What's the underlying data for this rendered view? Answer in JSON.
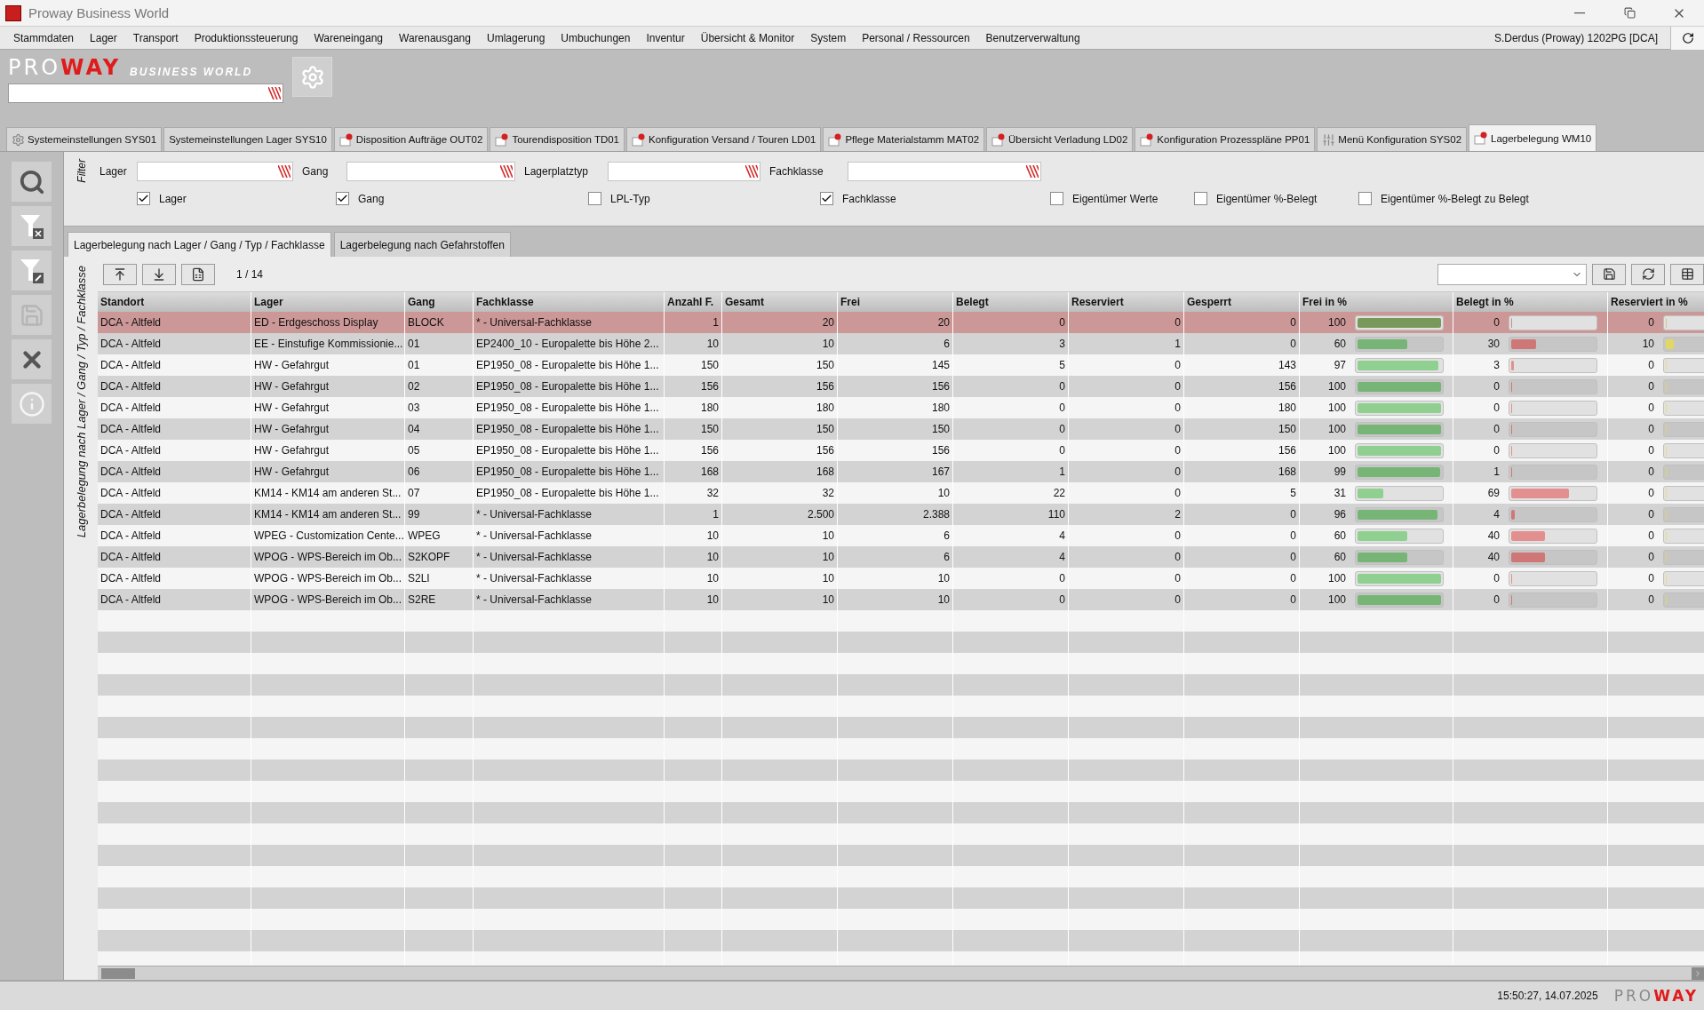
{
  "window": {
    "title": "Proway Business World"
  },
  "menu": {
    "items": [
      "Stammdaten",
      "Lager",
      "Transport",
      "Produktionssteuerung",
      "Wareneingang",
      "Warenausgang",
      "Umlagerung",
      "Umbuchungen",
      "Inventur",
      "Übersicht & Monitor",
      "System",
      "Personal / Ressourcen",
      "Benutzerverwaltung"
    ],
    "user": "S.Derdus (Proway) 1202PG [DCA]"
  },
  "logo": {
    "part_1": "PRO",
    "part_2": "WAY",
    "subtitle": "BUSINESS WORLD"
  },
  "tabs": [
    {
      "label": "Systemeinstellungen SYS01",
      "kind": "gear",
      "selected": false
    },
    {
      "label": "Systemeinstellungen Lager SYS10",
      "kind": "plain",
      "selected": false
    },
    {
      "label": "Disposition Aufträge OUT02",
      "kind": "document",
      "selected": false
    },
    {
      "label": "Tourendisposition TD01",
      "kind": "document",
      "selected": false
    },
    {
      "label": "Konfiguration Versand / Touren LD01",
      "kind": "document",
      "selected": false
    },
    {
      "label": "Pflege Materialstamm MAT02",
      "kind": "document",
      "selected": false
    },
    {
      "label": "Übersicht Verladung LD02",
      "kind": "document",
      "selected": false
    },
    {
      "label": "Konfiguration Prozesspläne PP01",
      "kind": "document",
      "selected": false
    },
    {
      "label": "Menü Konfiguration SYS02",
      "kind": "sliders",
      "selected": false
    },
    {
      "label": "Lagerbelegung WM10",
      "kind": "document",
      "selected": true
    }
  ],
  "filter": {
    "title": "Filter",
    "fields": [
      "Lager",
      "Gang",
      "Lagerplatztyp",
      "Fachklasse"
    ],
    "checkboxes": [
      {
        "label": "Lager",
        "checked": true
      },
      {
        "label": "Gang",
        "checked": true
      },
      {
        "label": "LPL-Typ",
        "checked": false
      },
      {
        "label": "Fachklasse",
        "checked": true
      },
      {
        "label": "Eigentümer Werte",
        "checked": false
      },
      {
        "label": "Eigentümer %-Belegt",
        "checked": false
      },
      {
        "label": "Eigentümer %-Belegt zu Belegt",
        "checked": false
      }
    ]
  },
  "subtabs": [
    {
      "label": "Lagerbelegung nach Lager / Gang / Typ / Fachklasse",
      "selected": true
    },
    {
      "label": "Lagerbelegung nach Gefahrstoffen",
      "selected": false
    }
  ],
  "side_label": "Lagerbelegung nach Lager / Gang / Typ / Fachklasse",
  "table": {
    "pager": "1 / 14",
    "columns": [
      "Standort",
      "Lager",
      "Gang",
      "Fachklasse",
      "Anzahl F.",
      "Gesamt",
      "Frei",
      "Belegt",
      "Reserviert",
      "Gesperrt",
      "Frei in %",
      "Belegt in %",
      "Reserviert in %"
    ],
    "rows": [
      {
        "selected": true,
        "cells": [
          "DCA - Altfeld",
          "ED - Erdgeschoss Display",
          "BLOCK",
          "* - Universal-Fachklasse",
          "1",
          "20",
          "20",
          "0",
          "0",
          "0"
        ],
        "bars": [
          {
            "value": "100",
            "level": 1
          },
          {
            "value": "0",
            "level": 0
          },
          {
            "value": "0",
            "level": 0
          }
        ]
      },
      {
        "selected": false,
        "cells": [
          "DCA - Altfeld",
          "EE - Einstufige Kommissionie...",
          "01",
          "EP2400_10 - Europalette bis Höhe 2...",
          "10",
          "10",
          "6",
          "3",
          "1",
          "0"
        ],
        "bars": [
          {
            "value": "60",
            "level": 0.6
          },
          {
            "value": "30",
            "level": 0.3
          },
          {
            "value": "10",
            "level": 0.1
          }
        ]
      },
      {
        "selected": false,
        "cells": [
          "DCA - Altfeld",
          "HW - Gefahrgut",
          "01",
          "EP1950_08 - Europalette bis Höhe 1...",
          "150",
          "150",
          "145",
          "5",
          "0",
          "143"
        ],
        "bars": [
          {
            "value": "97",
            "level": 0.97
          },
          {
            "value": "3",
            "level": 0.03
          },
          {
            "value": "0",
            "level": 0
          }
        ]
      },
      {
        "selected": false,
        "cells": [
          "DCA - Altfeld",
          "HW - Gefahrgut",
          "02",
          "EP1950_08 - Europalette bis Höhe 1...",
          "156",
          "156",
          "156",
          "0",
          "0",
          "156"
        ],
        "bars": [
          {
            "value": "100",
            "level": 1
          },
          {
            "value": "0",
            "level": 0
          },
          {
            "value": "0",
            "level": 0
          }
        ]
      },
      {
        "selected": false,
        "cells": [
          "DCA - Altfeld",
          "HW - Gefahrgut",
          "03",
          "EP1950_08 - Europalette bis Höhe 1...",
          "180",
          "180",
          "180",
          "0",
          "0",
          "180"
        ],
        "bars": [
          {
            "value": "100",
            "level": 1
          },
          {
            "value": "0",
            "level": 0
          },
          {
            "value": "0",
            "level": 0
          }
        ]
      },
      {
        "selected": false,
        "cells": [
          "DCA - Altfeld",
          "HW - Gefahrgut",
          "04",
          "EP1950_08 - Europalette bis Höhe 1...",
          "150",
          "150",
          "150",
          "0",
          "0",
          "150"
        ],
        "bars": [
          {
            "value": "100",
            "level": 1
          },
          {
            "value": "0",
            "level": 0
          },
          {
            "value": "0",
            "level": 0
          }
        ]
      },
      {
        "selected": false,
        "cells": [
          "DCA - Altfeld",
          "HW - Gefahrgut",
          "05",
          "EP1950_08 - Europalette bis Höhe 1...",
          "156",
          "156",
          "156",
          "0",
          "0",
          "156"
        ],
        "bars": [
          {
            "value": "100",
            "level": 1
          },
          {
            "value": "0",
            "level": 0
          },
          {
            "value": "0",
            "level": 0
          }
        ]
      },
      {
        "selected": false,
        "cells": [
          "DCA - Altfeld",
          "HW - Gefahrgut",
          "06",
          "EP1950_08 - Europalette bis Höhe 1...",
          "168",
          "168",
          "167",
          "1",
          "0",
          "168"
        ],
        "bars": [
          {
            "value": "99",
            "level": 0.99
          },
          {
            "value": "1",
            "level": 0.01
          },
          {
            "value": "0",
            "level": 0
          }
        ]
      },
      {
        "selected": false,
        "cells": [
          "DCA - Altfeld",
          "KM14 - KM14 am anderen St...",
          "07",
          "EP1950_08 - Europalette bis Höhe 1...",
          "32",
          "32",
          "10",
          "22",
          "0",
          "5"
        ],
        "bars": [
          {
            "value": "31",
            "level": 0.31
          },
          {
            "value": "69",
            "level": 0.69
          },
          {
            "value": "0",
            "level": 0
          }
        ]
      },
      {
        "selected": false,
        "cells": [
          "DCA - Altfeld",
          "KM14 - KM14 am anderen St...",
          "99",
          "* - Universal-Fachklasse",
          "1",
          "2.500",
          "2.388",
          "110",
          "2",
          "0"
        ],
        "bars": [
          {
            "value": "96",
            "level": 0.96
          },
          {
            "value": "4",
            "level": 0.04
          },
          {
            "value": "0",
            "level": 0
          }
        ]
      },
      {
        "selected": false,
        "cells": [
          "DCA - Altfeld",
          "WPEG - Customization Cente...",
          "WPEG",
          "* - Universal-Fachklasse",
          "10",
          "10",
          "6",
          "4",
          "0",
          "0"
        ],
        "bars": [
          {
            "value": "60",
            "level": 0.6
          },
          {
            "value": "40",
            "level": 0.4
          },
          {
            "value": "0",
            "level": 0
          }
        ]
      },
      {
        "selected": false,
        "cells": [
          "DCA - Altfeld",
          "WPOG - WPS-Bereich im Ob...",
          "S2KOPF",
          "* - Universal-Fachklasse",
          "10",
          "10",
          "6",
          "4",
          "0",
          "0"
        ],
        "bars": [
          {
            "value": "60",
            "level": 0.6
          },
          {
            "value": "40",
            "level": 0.4
          },
          {
            "value": "0",
            "level": 0
          }
        ]
      },
      {
        "selected": false,
        "cells": [
          "DCA - Altfeld",
          "WPOG - WPS-Bereich im Ob...",
          "S2LI",
          "* - Universal-Fachklasse",
          "10",
          "10",
          "10",
          "0",
          "0",
          "0"
        ],
        "bars": [
          {
            "value": "100",
            "level": 1
          },
          {
            "value": "0",
            "level": 0
          },
          {
            "value": "0",
            "level": 0
          }
        ]
      },
      {
        "selected": false,
        "cells": [
          "DCA - Altfeld",
          "WPOG - WPS-Bereich im Ob...",
          "S2RE",
          "* - Universal-Fachklasse",
          "10",
          "10",
          "10",
          "0",
          "0",
          "0"
        ],
        "bars": [
          {
            "value": "100",
            "level": 1
          },
          {
            "value": "0",
            "level": 0
          },
          {
            "value": "0",
            "level": 0
          }
        ]
      }
    ]
  },
  "status_bar": {
    "timestamp": "15:50:27, 14.07.2025",
    "logo": {
      "part_1": "PRO",
      "part_2": "WAY"
    }
  }
}
